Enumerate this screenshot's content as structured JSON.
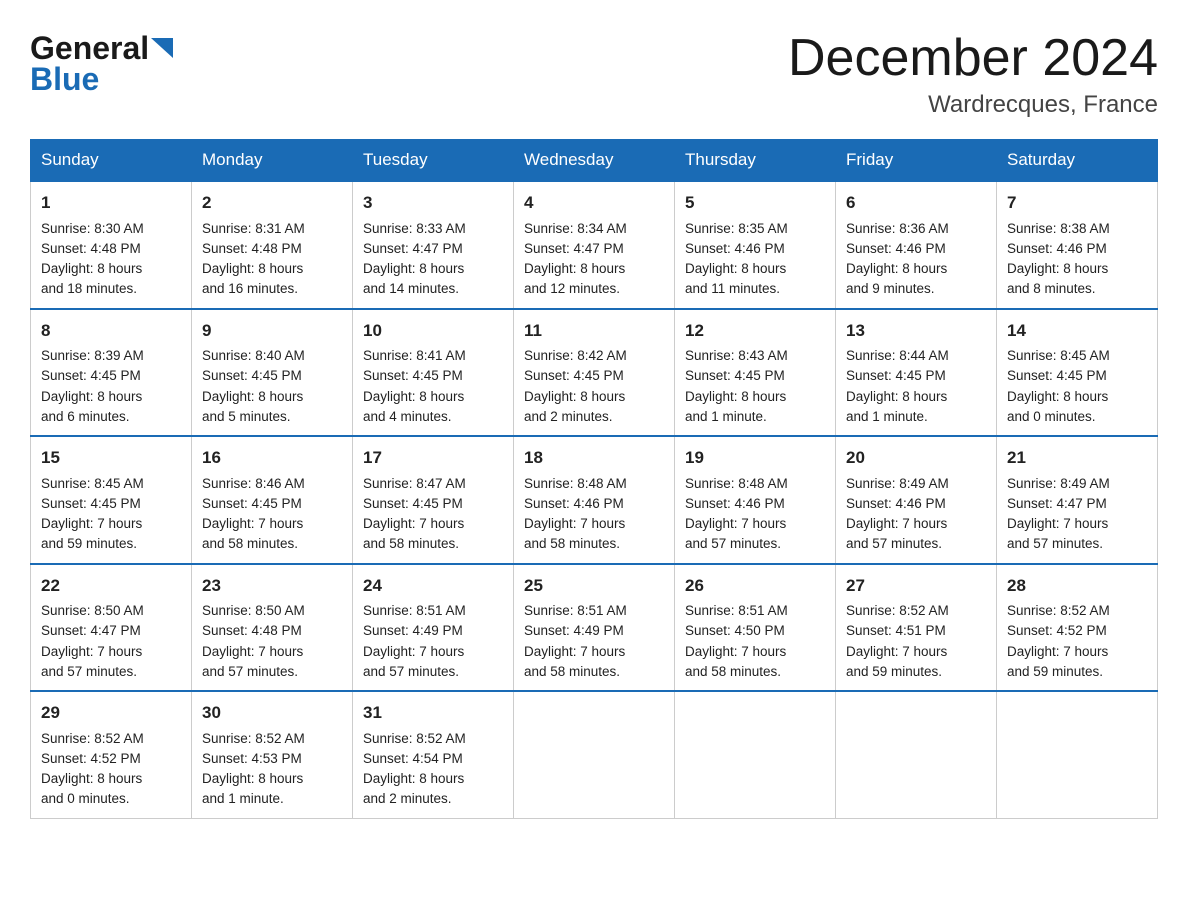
{
  "logo": {
    "line1": "General",
    "line2": "Blue"
  },
  "title": "December 2024",
  "subtitle": "Wardrecques, France",
  "days": [
    "Sunday",
    "Monday",
    "Tuesday",
    "Wednesday",
    "Thursday",
    "Friday",
    "Saturday"
  ],
  "weeks": [
    [
      {
        "num": "1",
        "sunrise": "Sunrise: 8:30 AM",
        "sunset": "Sunset: 4:48 PM",
        "daylight": "Daylight: 8 hours",
        "daylight2": "and 18 minutes."
      },
      {
        "num": "2",
        "sunrise": "Sunrise: 8:31 AM",
        "sunset": "Sunset: 4:48 PM",
        "daylight": "Daylight: 8 hours",
        "daylight2": "and 16 minutes."
      },
      {
        "num": "3",
        "sunrise": "Sunrise: 8:33 AM",
        "sunset": "Sunset: 4:47 PM",
        "daylight": "Daylight: 8 hours",
        "daylight2": "and 14 minutes."
      },
      {
        "num": "4",
        "sunrise": "Sunrise: 8:34 AM",
        "sunset": "Sunset: 4:47 PM",
        "daylight": "Daylight: 8 hours",
        "daylight2": "and 12 minutes."
      },
      {
        "num": "5",
        "sunrise": "Sunrise: 8:35 AM",
        "sunset": "Sunset: 4:46 PM",
        "daylight": "Daylight: 8 hours",
        "daylight2": "and 11 minutes."
      },
      {
        "num": "6",
        "sunrise": "Sunrise: 8:36 AM",
        "sunset": "Sunset: 4:46 PM",
        "daylight": "Daylight: 8 hours",
        "daylight2": "and 9 minutes."
      },
      {
        "num": "7",
        "sunrise": "Sunrise: 8:38 AM",
        "sunset": "Sunset: 4:46 PM",
        "daylight": "Daylight: 8 hours",
        "daylight2": "and 8 minutes."
      }
    ],
    [
      {
        "num": "8",
        "sunrise": "Sunrise: 8:39 AM",
        "sunset": "Sunset: 4:45 PM",
        "daylight": "Daylight: 8 hours",
        "daylight2": "and 6 minutes."
      },
      {
        "num": "9",
        "sunrise": "Sunrise: 8:40 AM",
        "sunset": "Sunset: 4:45 PM",
        "daylight": "Daylight: 8 hours",
        "daylight2": "and 5 minutes."
      },
      {
        "num": "10",
        "sunrise": "Sunrise: 8:41 AM",
        "sunset": "Sunset: 4:45 PM",
        "daylight": "Daylight: 8 hours",
        "daylight2": "and 4 minutes."
      },
      {
        "num": "11",
        "sunrise": "Sunrise: 8:42 AM",
        "sunset": "Sunset: 4:45 PM",
        "daylight": "Daylight: 8 hours",
        "daylight2": "and 2 minutes."
      },
      {
        "num": "12",
        "sunrise": "Sunrise: 8:43 AM",
        "sunset": "Sunset: 4:45 PM",
        "daylight": "Daylight: 8 hours",
        "daylight2": "and 1 minute."
      },
      {
        "num": "13",
        "sunrise": "Sunrise: 8:44 AM",
        "sunset": "Sunset: 4:45 PM",
        "daylight": "Daylight: 8 hours",
        "daylight2": "and 1 minute."
      },
      {
        "num": "14",
        "sunrise": "Sunrise: 8:45 AM",
        "sunset": "Sunset: 4:45 PM",
        "daylight": "Daylight: 8 hours",
        "daylight2": "and 0 minutes."
      }
    ],
    [
      {
        "num": "15",
        "sunrise": "Sunrise: 8:45 AM",
        "sunset": "Sunset: 4:45 PM",
        "daylight": "Daylight: 7 hours",
        "daylight2": "and 59 minutes."
      },
      {
        "num": "16",
        "sunrise": "Sunrise: 8:46 AM",
        "sunset": "Sunset: 4:45 PM",
        "daylight": "Daylight: 7 hours",
        "daylight2": "and 58 minutes."
      },
      {
        "num": "17",
        "sunrise": "Sunrise: 8:47 AM",
        "sunset": "Sunset: 4:45 PM",
        "daylight": "Daylight: 7 hours",
        "daylight2": "and 58 minutes."
      },
      {
        "num": "18",
        "sunrise": "Sunrise: 8:48 AM",
        "sunset": "Sunset: 4:46 PM",
        "daylight": "Daylight: 7 hours",
        "daylight2": "and 58 minutes."
      },
      {
        "num": "19",
        "sunrise": "Sunrise: 8:48 AM",
        "sunset": "Sunset: 4:46 PM",
        "daylight": "Daylight: 7 hours",
        "daylight2": "and 57 minutes."
      },
      {
        "num": "20",
        "sunrise": "Sunrise: 8:49 AM",
        "sunset": "Sunset: 4:46 PM",
        "daylight": "Daylight: 7 hours",
        "daylight2": "and 57 minutes."
      },
      {
        "num": "21",
        "sunrise": "Sunrise: 8:49 AM",
        "sunset": "Sunset: 4:47 PM",
        "daylight": "Daylight: 7 hours",
        "daylight2": "and 57 minutes."
      }
    ],
    [
      {
        "num": "22",
        "sunrise": "Sunrise: 8:50 AM",
        "sunset": "Sunset: 4:47 PM",
        "daylight": "Daylight: 7 hours",
        "daylight2": "and 57 minutes."
      },
      {
        "num": "23",
        "sunrise": "Sunrise: 8:50 AM",
        "sunset": "Sunset: 4:48 PM",
        "daylight": "Daylight: 7 hours",
        "daylight2": "and 57 minutes."
      },
      {
        "num": "24",
        "sunrise": "Sunrise: 8:51 AM",
        "sunset": "Sunset: 4:49 PM",
        "daylight": "Daylight: 7 hours",
        "daylight2": "and 57 minutes."
      },
      {
        "num": "25",
        "sunrise": "Sunrise: 8:51 AM",
        "sunset": "Sunset: 4:49 PM",
        "daylight": "Daylight: 7 hours",
        "daylight2": "and 58 minutes."
      },
      {
        "num": "26",
        "sunrise": "Sunrise: 8:51 AM",
        "sunset": "Sunset: 4:50 PM",
        "daylight": "Daylight: 7 hours",
        "daylight2": "and 58 minutes."
      },
      {
        "num": "27",
        "sunrise": "Sunrise: 8:52 AM",
        "sunset": "Sunset: 4:51 PM",
        "daylight": "Daylight: 7 hours",
        "daylight2": "and 59 minutes."
      },
      {
        "num": "28",
        "sunrise": "Sunrise: 8:52 AM",
        "sunset": "Sunset: 4:52 PM",
        "daylight": "Daylight: 7 hours",
        "daylight2": "and 59 minutes."
      }
    ],
    [
      {
        "num": "29",
        "sunrise": "Sunrise: 8:52 AM",
        "sunset": "Sunset: 4:52 PM",
        "daylight": "Daylight: 8 hours",
        "daylight2": "and 0 minutes."
      },
      {
        "num": "30",
        "sunrise": "Sunrise: 8:52 AM",
        "sunset": "Sunset: 4:53 PM",
        "daylight": "Daylight: 8 hours",
        "daylight2": "and 1 minute."
      },
      {
        "num": "31",
        "sunrise": "Sunrise: 8:52 AM",
        "sunset": "Sunset: 4:54 PM",
        "daylight": "Daylight: 8 hours",
        "daylight2": "and 2 minutes."
      },
      null,
      null,
      null,
      null
    ]
  ]
}
